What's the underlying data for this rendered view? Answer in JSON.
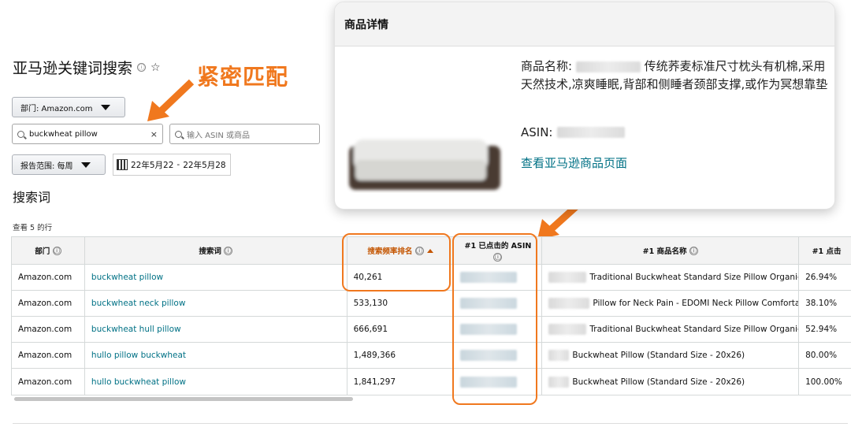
{
  "page": {
    "title": "亚马逊关键词搜索",
    "annotation": "紧密匹配"
  },
  "filters": {
    "department_label": "部门: Amazon.com",
    "search_value": "buckwheat pillow",
    "asin_placeholder": "输入 ASIN 或商品",
    "range_label": "报告范围: 每周",
    "date_start": "22年5月22",
    "date_separator": "-",
    "date_end": "22年5月28"
  },
  "section": {
    "title": "搜索词",
    "rows_count": "查看 5 的行"
  },
  "table": {
    "headers": {
      "department": "部门",
      "search_term": "搜索词",
      "frequency_rank": "搜索频率排名",
      "clicked_asin": "#1 已点击的 ASIN",
      "product_name": "#1 商品名称",
      "click_share": "#1 点击"
    },
    "rows": [
      {
        "department": "Amazon.com",
        "term": "buckwheat pillow",
        "rank": "40,261",
        "product": "Traditional Buckwheat Standard Size Pillow Organic...",
        "share": "26.94%"
      },
      {
        "department": "Amazon.com",
        "term": "buckwheat neck pillow",
        "rank": "533,130",
        "product": "Pillow for Neck Pain - EDOMI Neck Pillow Comforta...",
        "share": "38.10%"
      },
      {
        "department": "Amazon.com",
        "term": "buckwheat hull pillow",
        "rank": "666,691",
        "product": "Traditional Buckwheat Standard Size Pillow Organic...",
        "share": "52.94%"
      },
      {
        "department": "Amazon.com",
        "term": "hullo pillow buckwheat",
        "rank": "1,489,366",
        "product": "Buckwheat Pillow (Standard Size - 20x26)",
        "share": "80.00%"
      },
      {
        "department": "Amazon.com",
        "term": "hullo buckwheat pillow",
        "rank": "1,841,297",
        "product": "Buckwheat Pillow (Standard Size - 20x26)",
        "share": "100.00%"
      }
    ]
  },
  "popover": {
    "title": "商品详情",
    "name_prefix": "商品名称:",
    "name_text": "传统荞麦标准尺寸枕头有机棉,采用天然技术,凉爽睡眠,背部和侧睡者颈部支撑,或作为冥想靠垫",
    "asin_label": "ASIN:",
    "link": "查看亚马逊商品页面"
  },
  "icons": {
    "info": "ⓘ",
    "star": "☆",
    "clear": "×"
  },
  "colors": {
    "annotation": "#f0781e",
    "link": "#007185",
    "sorted_header": "#c45500"
  }
}
